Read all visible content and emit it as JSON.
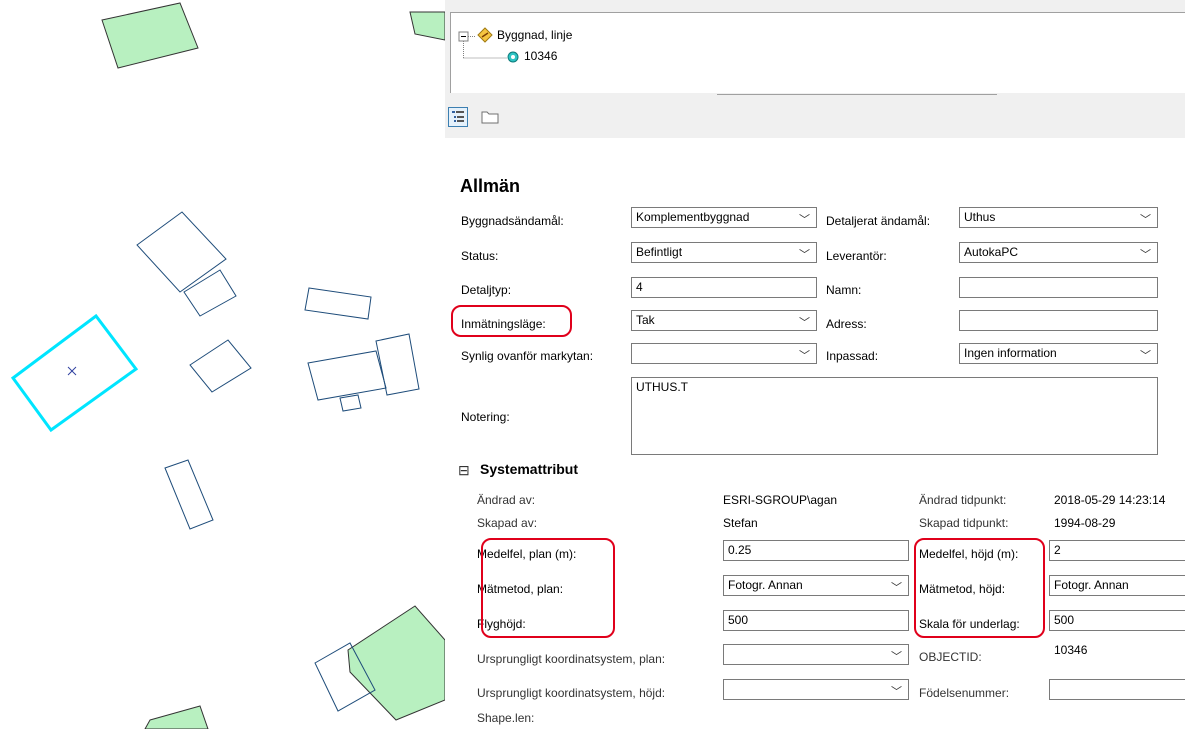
{
  "tree": {
    "layer_label": "Byggnad, linje",
    "object_id": "10346"
  },
  "toolbar": {
    "categorized_icon": "categorized-list-icon",
    "folder_icon": "folder-icon"
  },
  "general": {
    "title": "Allmän",
    "byggnadsandamal_label": "Byggnadsändamål:",
    "byggnadsandamal_value": "Komplementbyggnad",
    "detaljerat_andamal_label": "Detaljerat ändamål:",
    "detaljerat_andamal_value": "Uthus",
    "status_label": "Status:",
    "status_value": "Befintligt",
    "leverantor_label": "Leverantör:",
    "leverantor_value": "AutokaPC",
    "detaljtyp_label": "Detaljtyp:",
    "detaljtyp_value": "4",
    "namn_label": "Namn:",
    "namn_value": "",
    "inmatningslage_label": "Inmätningsläge:",
    "inmatningslage_value": "Tak",
    "adress_label": "Adress:",
    "adress_value": "",
    "synlig_label": "Synlig ovanför markytan:",
    "synlig_value": "",
    "inpassad_label": "Inpassad:",
    "inpassad_value": "Ingen information",
    "notering_label": "Notering:",
    "notering_value": "UTHUS.T"
  },
  "system": {
    "collapse_glyph": "⊟",
    "title": "Systemattribut",
    "andrad_av_label": "Ändrad av:",
    "andrad_av_value": "ESRI-SGROUP\\agan",
    "andrad_tid_label": "Ändrad tidpunkt:",
    "andrad_tid_value": "2018-05-29 14:23:14",
    "skapad_av_label": "Skapad av:",
    "skapad_av_value": "Stefan",
    "skapad_tid_label": "Skapad tidpunkt:",
    "skapad_tid_value": "1994-08-29",
    "medelfel_plan_label": "Medelfel, plan (m):",
    "medelfel_plan_value": "0.25",
    "medelfel_hojd_label": "Medelfel, höjd (m):",
    "medelfel_hojd_value": "2",
    "matmetod_plan_label": "Mätmetod, plan:",
    "matmetod_plan_value": "Fotogr. Annan",
    "matmetod_hojd_label": "Mätmetod, höjd:",
    "matmetod_hojd_value": "Fotogr. Annan",
    "flyghojd_label": "Flyghöjd:",
    "flyghojd_value": "500",
    "skala_label": "Skala för underlag:",
    "skala_value": "500",
    "koord_plan_label": "Ursprungligt koordinatsystem, plan:",
    "koord_plan_value": "",
    "objectid_label": "OBJECTID:",
    "objectid_value": "10346",
    "koord_hojd_label": "Ursprungligt koordinatsystem, höjd:",
    "koord_hojd_value": "",
    "fodelsenummer_label": "Födelsenummer:",
    "fodelsenummer_value": "",
    "shape_len_label": "Shape.len:"
  },
  "colors": {
    "building_fill": "#b8f0c0",
    "building_outline": "#1e4c7a",
    "selection": "#00e5ff",
    "callout": "#e0001b"
  },
  "icons": {
    "dropdown": "chevron-down-icon",
    "selection_marker": "cross-icon"
  }
}
